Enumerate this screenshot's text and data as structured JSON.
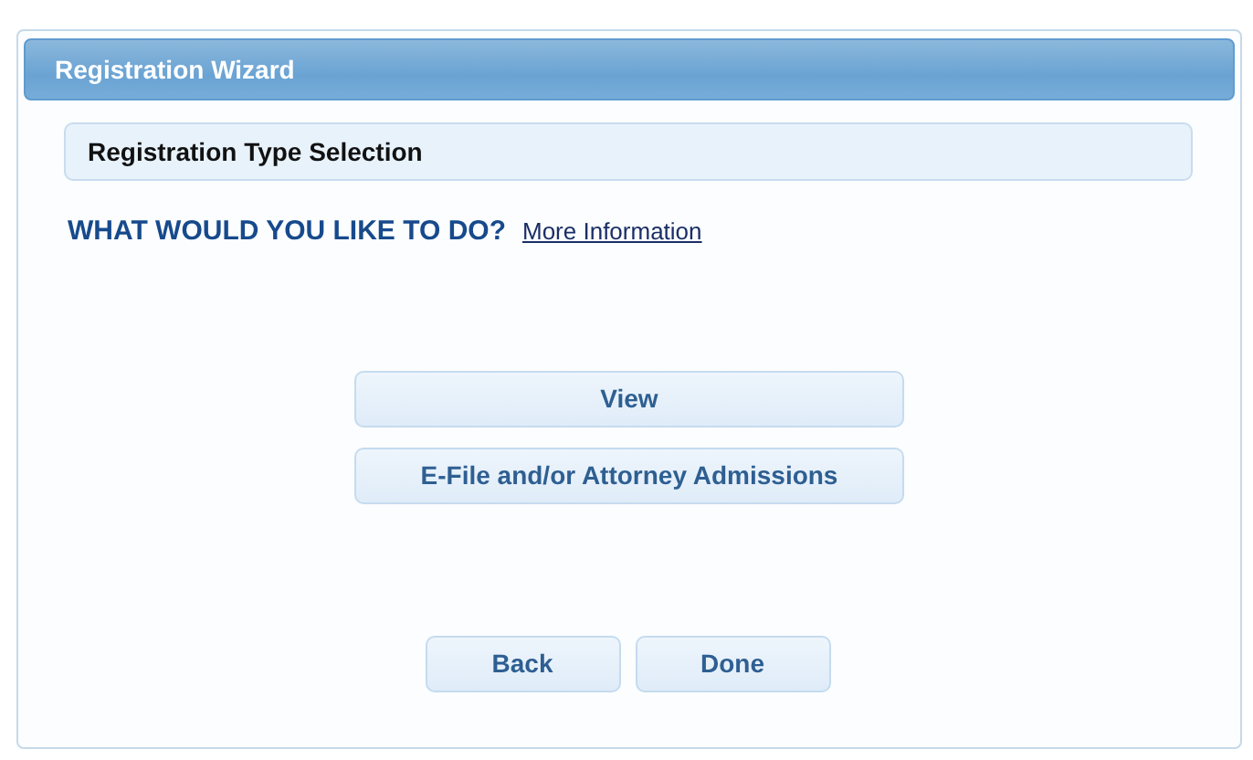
{
  "window": {
    "title": "Registration Wizard"
  },
  "section": {
    "title": "Registration Type Selection"
  },
  "prompt": {
    "question": "WHAT WOULD YOU LIKE TO DO?",
    "link": "More Information"
  },
  "options": [
    "View",
    "E-File and/or Attorney Admissions"
  ],
  "buttons": [
    "Back",
    "Done"
  ]
}
